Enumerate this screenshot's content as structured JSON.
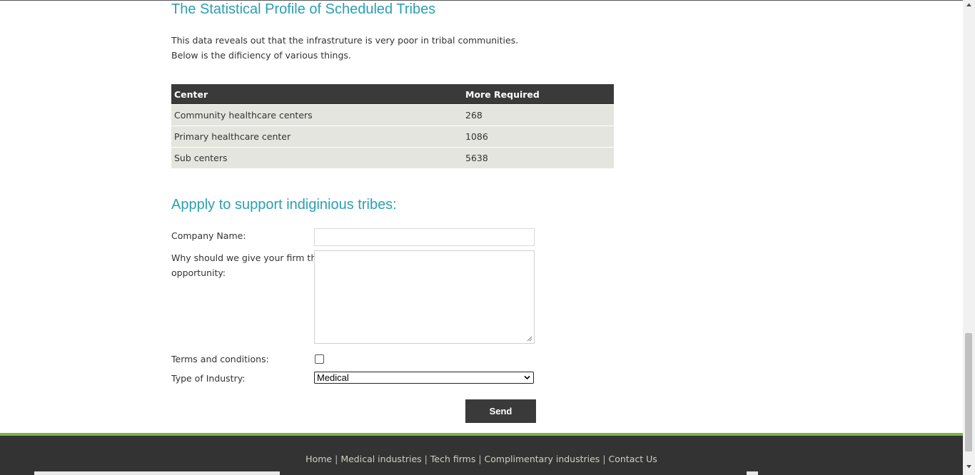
{
  "section": {
    "title": "The Statistical Profile of Scheduled Tribes",
    "intro_line1": "This data reveals out that the infrastruture is very poor in tribal communities.",
    "intro_line2": "Below is the dificiency of various things."
  },
  "stats_table": {
    "headers": [
      "Center",
      "More Required"
    ],
    "rows": [
      [
        "Community healthcare centers",
        "268"
      ],
      [
        "Primary healthcare center",
        "1086"
      ],
      [
        "Sub centers",
        "5638"
      ]
    ]
  },
  "form": {
    "title": "Appply to support indiginious tribes:",
    "company_label": "Company Name:",
    "company_value": "",
    "reason_label_line1": "Why should we give your firm this",
    "reason_label_line2": "opportunity:",
    "reason_value": "",
    "terms_label": "Terms and conditions:",
    "terms_checked": false,
    "industry_label": "Type of Industry:",
    "industry_selected": "Medical",
    "send_label": "Send"
  },
  "footer": {
    "links": [
      "Home",
      "Medical industries",
      "Tech firms",
      "Complimentary industries",
      "Contact Us"
    ],
    "separator": "|"
  },
  "colors": {
    "heading": "#2a9fb3",
    "table_header_bg": "#3a3a3a",
    "table_row_bg": "#e5e5df",
    "footer_bg": "#333333",
    "footer_accent": "#7cb342"
  },
  "icons": {
    "select_chevron": "chevron-down-icon",
    "textarea_grip": "resize-grip-icon",
    "scroll_up": "scroll-up-arrow-icon",
    "scroll_down": "scroll-down-arrow-icon"
  }
}
